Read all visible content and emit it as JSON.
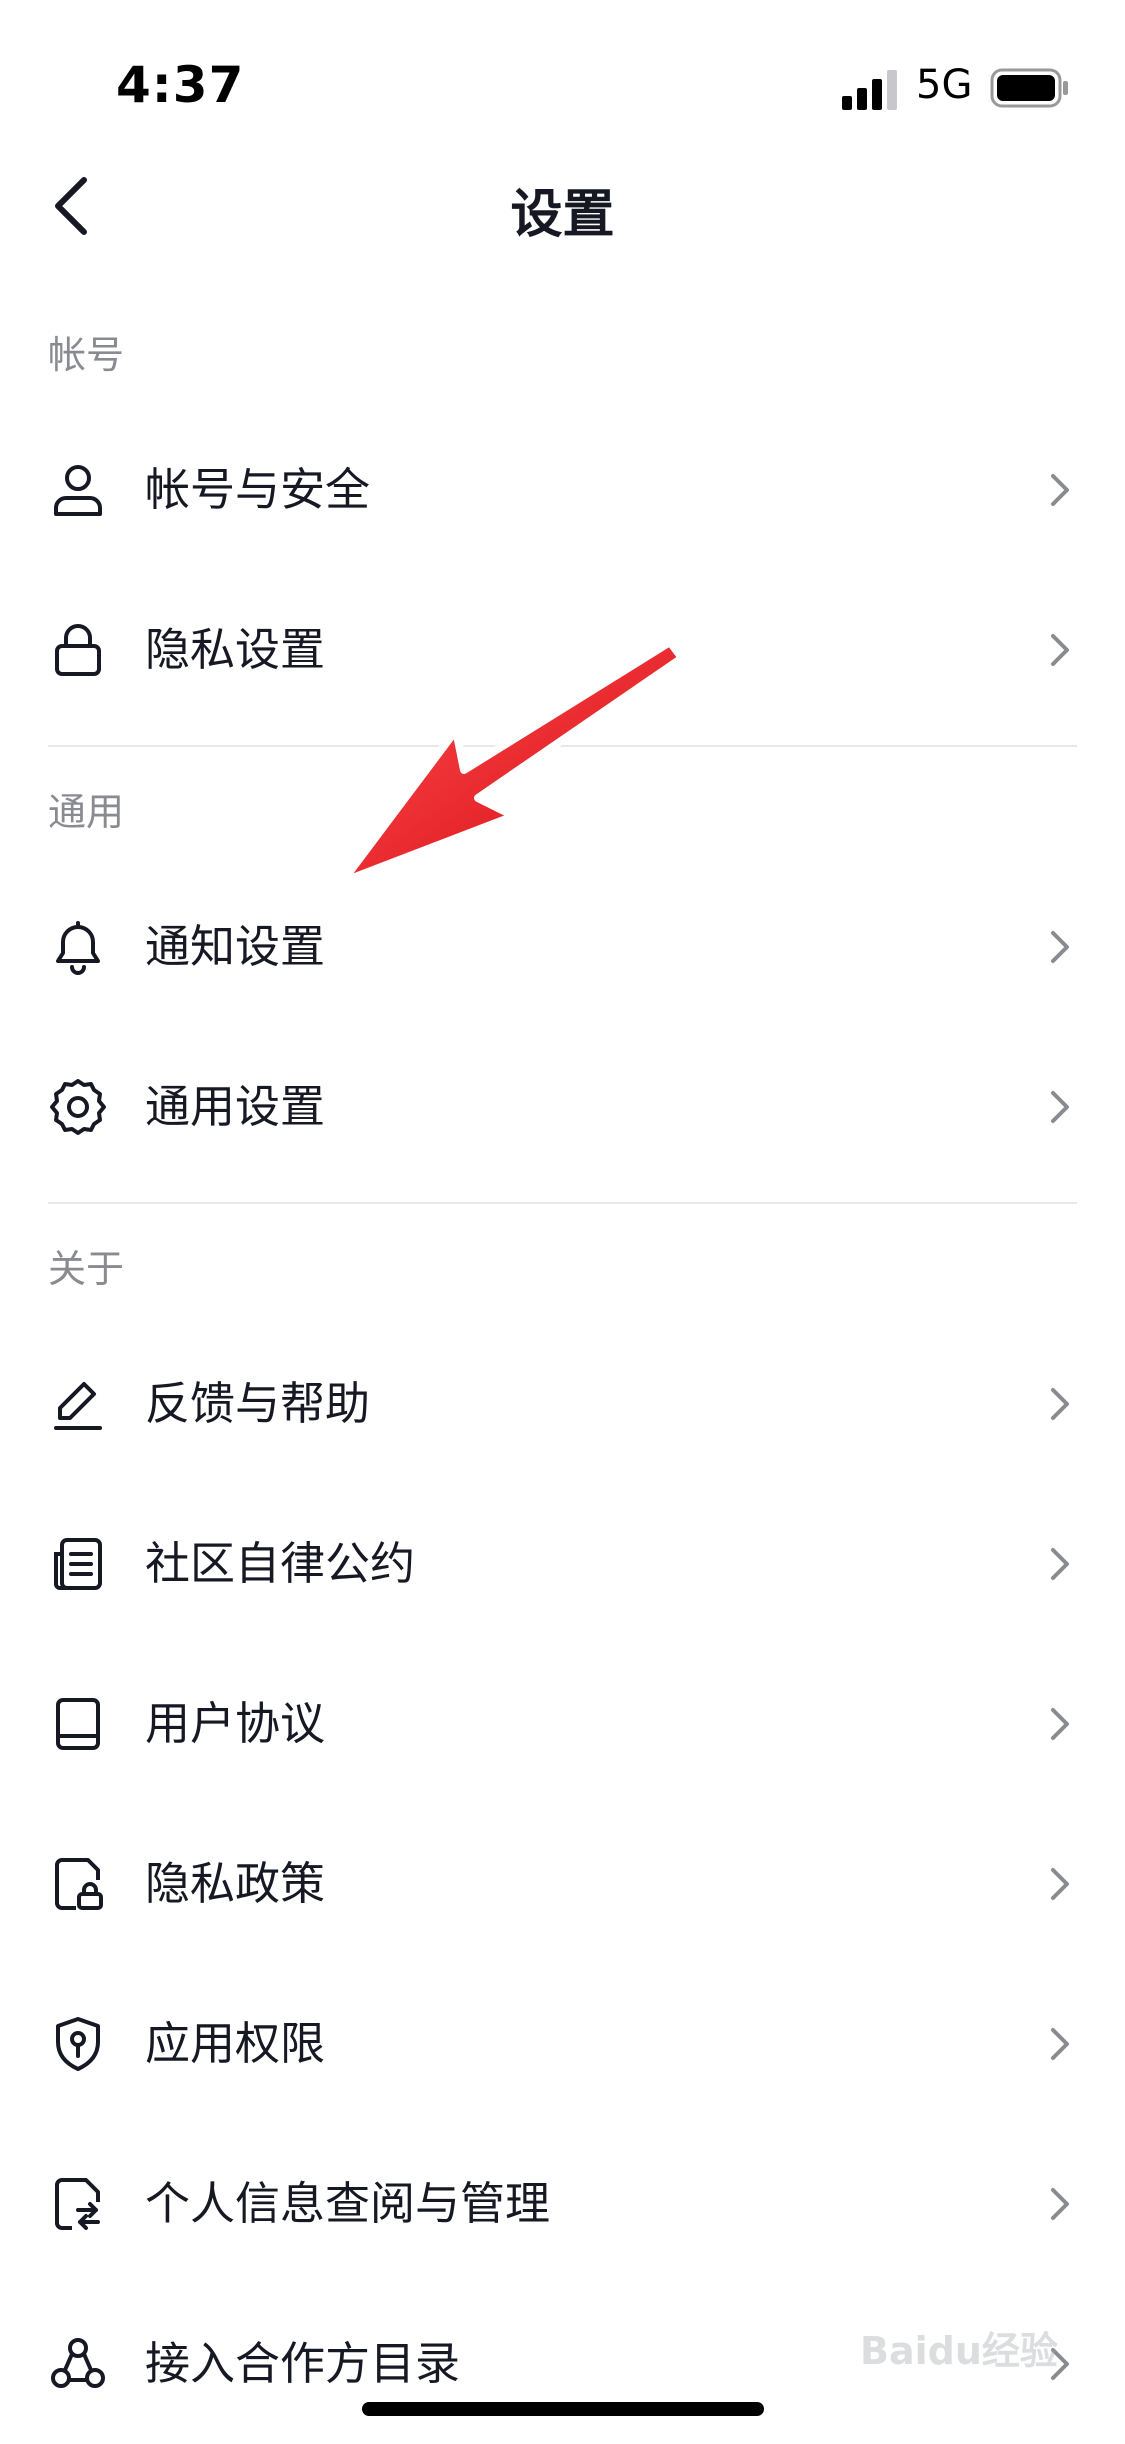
{
  "status_bar": {
    "time": "4:37",
    "network": "5G"
  },
  "header": {
    "title": "设置"
  },
  "sections": [
    {
      "title": "帐号",
      "items": [
        {
          "label": "帐号与安全",
          "icon": "person-icon"
        },
        {
          "label": "隐私设置",
          "icon": "lock-icon"
        }
      ]
    },
    {
      "title": "通用",
      "items": [
        {
          "label": "通知设置",
          "icon": "bell-icon"
        },
        {
          "label": "通用设置",
          "icon": "gear-icon"
        }
      ]
    },
    {
      "title": "关于",
      "items": [
        {
          "label": "反馈与帮助",
          "icon": "pencil-icon"
        },
        {
          "label": "社区自律公约",
          "icon": "document-icon"
        },
        {
          "label": "用户协议",
          "icon": "book-icon"
        },
        {
          "label": "隐私政策",
          "icon": "file-lock-icon"
        },
        {
          "label": "应用权限",
          "icon": "shield-icon"
        },
        {
          "label": "个人信息查阅与管理",
          "icon": "file-swap-icon"
        },
        {
          "label": "接入合作方目录",
          "icon": "partners-icon"
        }
      ]
    }
  ],
  "watermark": {
    "text": "Baidu经验"
  },
  "colors": {
    "text": "#161823",
    "muted": "#8a8b91",
    "divider": "#e8e8ea",
    "annotation_arrow": "#e8131d"
  }
}
